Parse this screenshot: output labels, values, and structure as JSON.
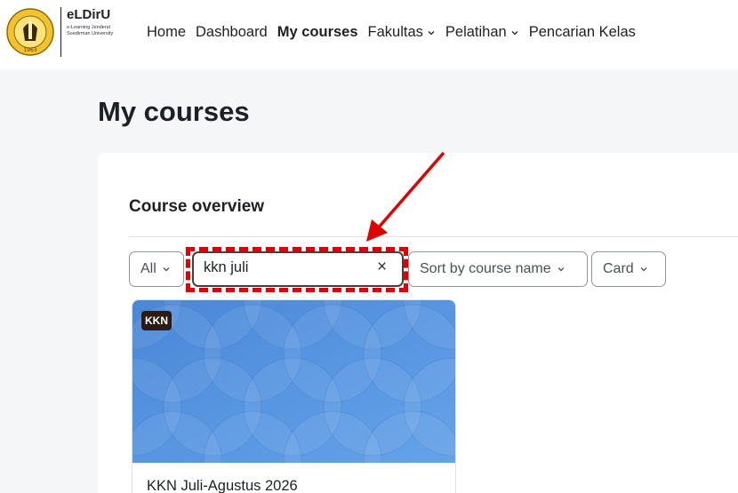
{
  "brand": {
    "name": "eLDirU",
    "subtitle": "e-Learning Jenderal Soedirman University",
    "seal_text": "1963"
  },
  "nav": [
    {
      "label": "Home",
      "dropdown": false,
      "active": false
    },
    {
      "label": "Dashboard",
      "dropdown": false,
      "active": false
    },
    {
      "label": "My courses",
      "dropdown": false,
      "active": true
    },
    {
      "label": "Fakultas",
      "dropdown": true,
      "active": false
    },
    {
      "label": "Pelatihan",
      "dropdown": true,
      "active": false
    },
    {
      "label": "Pencarian Kelas",
      "dropdown": false,
      "active": false
    }
  ],
  "page": {
    "title": "My courses"
  },
  "overview": {
    "title": "Course overview",
    "filter_label": "All",
    "search_value": "kkn juli",
    "clear_icon": "×",
    "sort_label": "Sort by course name",
    "view_label": "Card"
  },
  "course": {
    "short_name": "KKN",
    "full_name": "KKN Juli-Agustus 2026"
  },
  "colors": {
    "annotation": "#e10000",
    "course_image": "#4a8fdd",
    "badge": "#2d1b14"
  }
}
